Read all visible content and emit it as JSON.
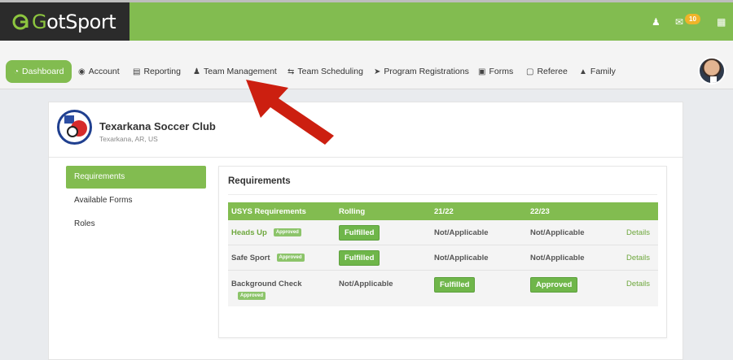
{
  "brand": {
    "logo_text_head": "G",
    "logo_text_tail": "otSport",
    "notification_count": "10"
  },
  "nav": {
    "items": [
      {
        "label": "Dashboard",
        "icon": "dashboard-icon",
        "active": true
      },
      {
        "label": "Account",
        "icon": "account-icon"
      },
      {
        "label": "Reporting",
        "icon": "document-icon"
      },
      {
        "label": "Team Management",
        "icon": "users-icon"
      },
      {
        "label": "Team Scheduling",
        "icon": "swap-icon"
      },
      {
        "label": "Program Registrations",
        "icon": "paper-plane-icon"
      },
      {
        "label": "Forms",
        "icon": "file-icon"
      },
      {
        "label": "Referee",
        "icon": "calendar-icon"
      },
      {
        "label": "Family",
        "icon": "sitemap-icon"
      }
    ]
  },
  "club": {
    "name": "Texarkana Soccer Club",
    "location": "Texarkana, AR, US"
  },
  "sidebar": {
    "items": [
      "Requirements",
      "Available Forms",
      "Roles"
    ]
  },
  "panel": {
    "title": "Requirements",
    "headers": [
      "USYS Requirements",
      "Rolling",
      "21/22",
      "22/23"
    ],
    "rows": [
      {
        "name": "Heads Up",
        "tag": "Approved",
        "rolling": "Fulfilled",
        "y2122": "Not/Applicable",
        "y2223": "Not/Applicable",
        "action": "Details"
      },
      {
        "name": "Safe Sport",
        "tag": "Approved",
        "rolling": "Fulfilled",
        "y2122": "Not/Applicable",
        "y2223": "Not/Applicable",
        "action": "Details"
      },
      {
        "name": "Background Check",
        "tag": "Approved",
        "rolling": "Not/Applicable",
        "y2122": "Fulfilled",
        "y2223": "Approved",
        "action": "Details"
      }
    ]
  },
  "colors": {
    "brand_green": "#82bc50",
    "dark": "#2b2b2b",
    "arrow_red": "#cc1f10"
  }
}
